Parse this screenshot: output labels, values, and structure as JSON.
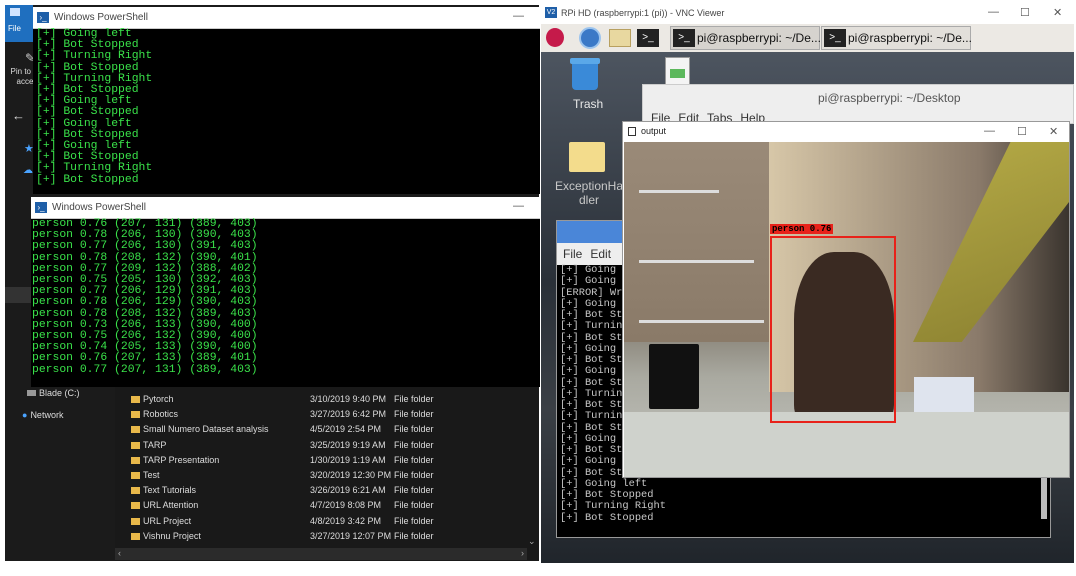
{
  "explorer": {
    "ribbon_tab": "File",
    "pin_label_1": "Pin to Q",
    "pin_label_2": "acce",
    "nav_items": [
      "Blade (C:)",
      "Network"
    ],
    "rows": [
      {
        "name": "Pytorch",
        "date": "3/10/2019 9:40 PM",
        "type": "File folder"
      },
      {
        "name": "Robotics",
        "date": "3/27/2019 6:42 PM",
        "type": "File folder"
      },
      {
        "name": "Small Numero Dataset analysis",
        "date": "4/5/2019 2:54 PM",
        "type": "File folder"
      },
      {
        "name": "TARP",
        "date": "3/25/2019 9:19 AM",
        "type": "File folder"
      },
      {
        "name": "TARP Presentation",
        "date": "1/30/2019 1:19 AM",
        "type": "File folder"
      },
      {
        "name": "Test",
        "date": "3/20/2019 12:30 PM",
        "type": "File folder"
      },
      {
        "name": "Text Tutorials",
        "date": "3/26/2019 6:21 AM",
        "type": "File folder"
      },
      {
        "name": "URL Attention",
        "date": "4/7/2019 8:08 PM",
        "type": "File folder"
      },
      {
        "name": "URL Project",
        "date": "4/8/2019 3:42 PM",
        "type": "File folder"
      },
      {
        "name": "Vishnu Project",
        "date": "3/27/2019 12:07 PM",
        "type": "File folder"
      }
    ]
  },
  "ps1": {
    "title": "Windows PowerShell",
    "lines": [
      "[+] Going left",
      "[+] Bot Stopped",
      "[+] Turning Right",
      "[+] Bot Stopped",
      "[+] Turning Right",
      "[+] Bot Stopped",
      "[+] Going left",
      "[+] Bot Stopped",
      "[+] Going left",
      "[+] Bot Stopped",
      "[+] Going left",
      "[+] Bot Stopped",
      "[+] Turning Right",
      "[+] Bot Stopped"
    ]
  },
  "ps2": {
    "title": "Windows PowerShell",
    "lines": [
      "person 0.76 (207, 131) (389, 403)",
      "person 0.78 (206, 130) (390, 403)",
      "person 0.77 (206, 130) (391, 403)",
      "person 0.78 (208, 132) (390, 401)",
      "person 0.77 (209, 132) (388, 402)",
      "person 0.75 (205, 130) (392, 403)",
      "person 0.77 (206, 129) (391, 403)",
      "person 0.78 (206, 129) (390, 403)",
      "person 0.78 (208, 132) (389, 403)",
      "person 0.73 (206, 133) (390, 400)",
      "person 0.75 (206, 132) (390, 400)",
      "person 0.74 (205, 133) (390, 400)",
      "person 0.76 (207, 133) (389, 401)",
      "person 0.77 (207, 131) (389, 403)"
    ]
  },
  "vnc": {
    "title": "RPi HD (raspberrypi:1 (pi)) - VNC Viewer",
    "logo": "V2",
    "task1": "pi@raspberrypi: ~/De...",
    "task2": "pi@raspberrypi: ~/De...",
    "trash_label": "Trash",
    "folder_label_1": "ExceptionHa",
    "folder_label_2": "dler",
    "term_title": "pi@raspberrypi: ~/Desktop",
    "term_menu": [
      "File",
      "Edit",
      "Tabs",
      "Help"
    ],
    "term2_menu": [
      "File",
      "Edit"
    ],
    "term2_lines": [
      "[+] Going E",
      "[+] Going E",
      "[ERROR] Wro",
      "[+] Going R",
      "[+] Bot Sto",
      "[+] Turning",
      "[+] Bot Sto",
      "[+] Going l",
      "[+] Bot Sto",
      "[+] Going l",
      "[+] Bot Sto",
      "[+] Turning",
      "[+] Bot Sto",
      "[+] Turning",
      "[+] Bot Sto",
      "[+] Going l",
      "[+] Bot Sto",
      "[+] Going l",
      "[+] Bot Sto",
      "[+] Going left",
      "[+] Bot Stopped",
      "[+] Turning Right",
      "[+] Bot Stopped"
    ],
    "output_title": "output",
    "detection_label": "person 0.76"
  }
}
